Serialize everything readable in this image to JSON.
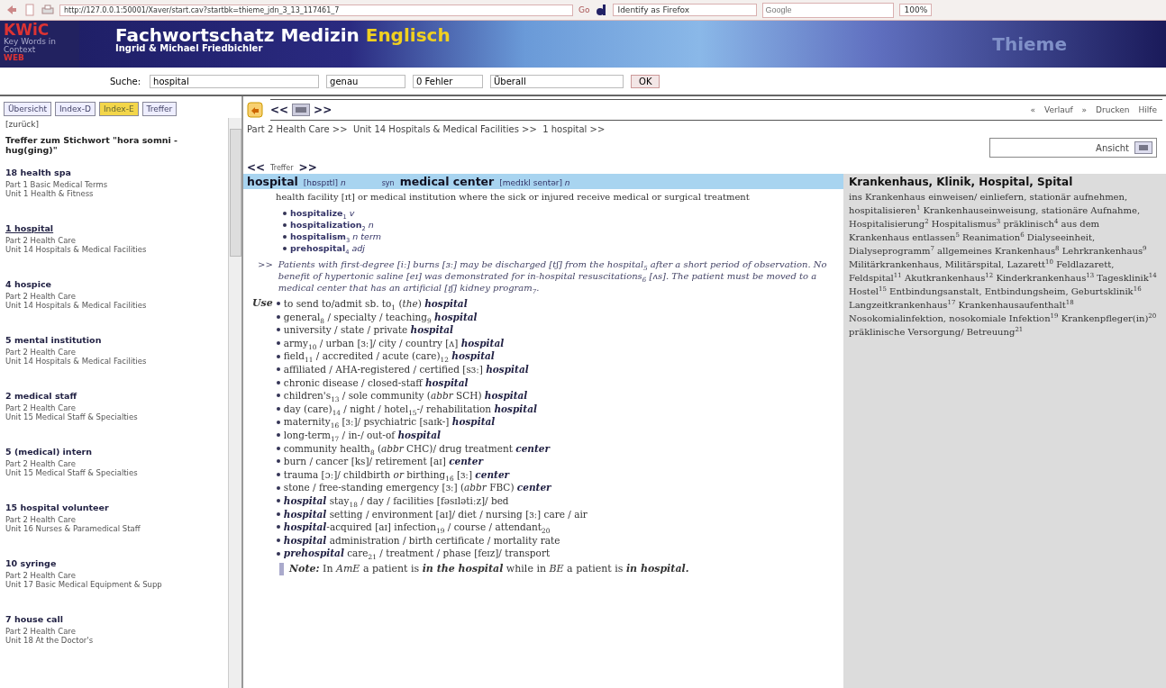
{
  "browser": {
    "url": "http://127.0.0.1:50001/Xaver/start.cav?startbk=thieme_jdn_3_13_117461_7",
    "go": "Go",
    "identify": "Identify as Firefox",
    "search_placeholder": "Google",
    "zoom": "100%"
  },
  "header": {
    "logo_main": "KWiC",
    "logo_sub": "Key Words in Context",
    "logo_web": "WEB",
    "title": "Fachwortschatz Medizin",
    "title_accent": "Englisch",
    "subtitle": "Ingrid & Michael Friedbichler",
    "publisher": "Thieme"
  },
  "search": {
    "label": "Suche:",
    "value": "hospital",
    "mode": "genau",
    "errors": "0 Fehler",
    "scope": "Überall",
    "ok": "OK"
  },
  "sidebar": {
    "tabs": [
      {
        "label": "Übersicht",
        "selected": false
      },
      {
        "label": "Index-D",
        "selected": false
      },
      {
        "label": "Index-E",
        "selected": true
      },
      {
        "label": "Treffer",
        "selected": false
      }
    ],
    "back": "[zurück]",
    "heading": "Treffer zum Stichwort \"hora somni - hug(ging)\"",
    "items": [
      {
        "title": "18 health spa",
        "part": "Part 1 Basic Medical Terms",
        "unit": "Unit 1 Health & Fitness",
        "selected": false
      },
      {
        "title": "1 hospital",
        "part": "Part 2 Health Care",
        "unit": "Unit 14 Hospitals & Medical Facilities",
        "selected": true
      },
      {
        "title": "4 hospice",
        "part": "Part 2 Health Care",
        "unit": "Unit 14 Hospitals & Medical Facilities",
        "selected": false
      },
      {
        "title": "5 mental institution",
        "part": "Part 2 Health Care",
        "unit": "Unit 14 Hospitals & Medical Facilities",
        "selected": false
      },
      {
        "title": "2 medical staff",
        "part": "Part 2 Health Care",
        "unit": "Unit 15 Medical Staff & Specialties",
        "selected": false
      },
      {
        "title": "5 (medical) intern",
        "part": "Part 2 Health Care",
        "unit": "Unit 15 Medical Staff & Specialties",
        "selected": false
      },
      {
        "title": "15 hospital volunteer",
        "part": "Part 2 Health Care",
        "unit": "Unit 16 Nurses & Paramedical Staff",
        "selected": false
      },
      {
        "title": "10 syringe",
        "part": "Part 2 Health Care",
        "unit": "Unit 17 Basic Medical Equipment & Supp",
        "selected": false
      },
      {
        "title": "7 house call",
        "part": "Part 2 Health Care",
        "unit": "Unit 18 At the Doctor's",
        "selected": false
      }
    ]
  },
  "nav": {
    "prev": "<<",
    "next": ">>",
    "history_back": "«",
    "history": "Verlauf",
    "history_forward": "»",
    "print": "Drucken",
    "help": "Hilfe"
  },
  "breadcrumb": "Part 2 Health Care >>  Unit 14 Hospitals & Medical Facilities >>  1 hospital >>",
  "view": {
    "label": "Ansicht"
  },
  "hits": {
    "prev": "<<",
    "label": "Treffer",
    "next": ">>"
  },
  "entry": {
    "headword": "hospital",
    "pron": "[hɒspɪtl]",
    "pos": "n",
    "syn_label": "syn",
    "synonym": "medical center",
    "syn_pron": "[medɪkl sentər]",
    "syn_pos": "n",
    "definition": "health facility [ɪt] or medical institution where the sick or injured receive medical or surgical treatment",
    "derivatives": [
      {
        "word": "hospitalize",
        "num": "1",
        "pos": "v"
      },
      {
        "word": "hospitalization",
        "num": "2",
        "pos": "n"
      },
      {
        "word": "hospitalism",
        "num": "3",
        "pos": "n term"
      },
      {
        "word": "prehospital",
        "num": "4",
        "pos": "adj"
      }
    ],
    "example_marker": ">>",
    "example": "Patients with first-degree [iː] burns [ɜː] may be discharged [tʃ] from the hospital$_{5}$ after a short period of observation. No benefit of hypertonic saline [eɪ] was demonstrated for in-hospital resuscitations$_{6}$ [ʌs]. The patient must be moved to a medical center that has an artificial [ɪʃ] kidney program$_{7}$.",
    "use_label": "Use",
    "uses": [
      "to send to/admit sb. to$_{1}$ (*the*) **hospital**",
      "general$_{8}$ / specialty / teaching$_{9}$ **hospital**",
      "university / state / private **hospital**",
      "army$_{10}$ / urban [ɜː]/ city / country [ʌ] **hospital**",
      "field$_{11}$ / accredited / acute (care)$_{12}$ **hospital**",
      "affiliated / AHA-registered / certified [sɜː] **hospital**",
      "chronic disease / closed-staff **hospital**",
      "children's$_{13}$ / sole community (*abbr* SCH) **hospital**",
      "day (care)$_{14}$ / night / hotel$_{15}$-/ rehabilitation **hospital**",
      "maternity$_{16}$ [ɜː]/ psychiatric [saɪk-] **hospital**",
      "long-term$_{17}$ / in-/ out-of **hospital**",
      "community health$_{8}$ (*abbr* CHC)/ drug treatment **center**",
      "burn / cancer [ks]/ retirement [aɪ] **center**",
      "trauma [ɔː]/ childbirth *or* birthing$_{16}$ [ɜː] **center**",
      "stone / free-standing emergency [ɜː] (*abbr* FBC) **center**",
      "**hospital** stay$_{18}$ / day / facilities [fəsɪlətiːz]/ bed",
      "**hospital** setting / environment [aɪ]/ diet / nursing [ɜː] care / air",
      "**hospital**-acquired [aɪ] infection$_{19}$ / course / attendant$_{20}$",
      "**hospital** administration / birth certificate / mortality rate",
      "**prehospital** care$_{21}$ / treatment / phase [feɪz]/ transport"
    ],
    "note_label": "Note:",
    "note": "In *AmE* a patient is **in the hospital** while in *BE* a patient is **in hospital.**"
  },
  "translation": {
    "title": "Krankenhaus, Klinik, Hospital, Spital",
    "text": "ins Krankenhaus einweisen/ einliefern, stationär aufnehmen, hospitalisieren$^{1}$ Krankenhauseinweisung, stationäre Aufnahme, Hospitalisierung$^{2}$ Hospitalismus$^{3}$ präklinisch$^{4}$ aus dem Krankenhaus entlassen$^{5}$ Reanimation$^{6}$ Dialyseeinheit, Dialyseprogramm$^{7}$ allgemeines Krankenhaus$^{8}$ Lehrkrankenhaus$^{9}$ Militärkrankenhaus, Militärspital, Lazarett$^{10}$ Feldlazarett, Feldspital$^{11}$ Akutkrankenhaus$^{12}$ Kinderkrankenhaus$^{13}$ Tagesklinik$^{14}$ Hostel$^{15}$ Entbindungsanstalt, Entbindungsheim, Geburtsklinik$^{16}$ Langzeitkrankenhaus$^{17}$ Krankenhausaufenthalt$^{18}$ Nosokomialinfektion, nosokomiale Infektion$^{19}$ Krankenpfleger(in)$^{20}$ präklinische Versorgung/ Betreuung$^{21}$"
  }
}
